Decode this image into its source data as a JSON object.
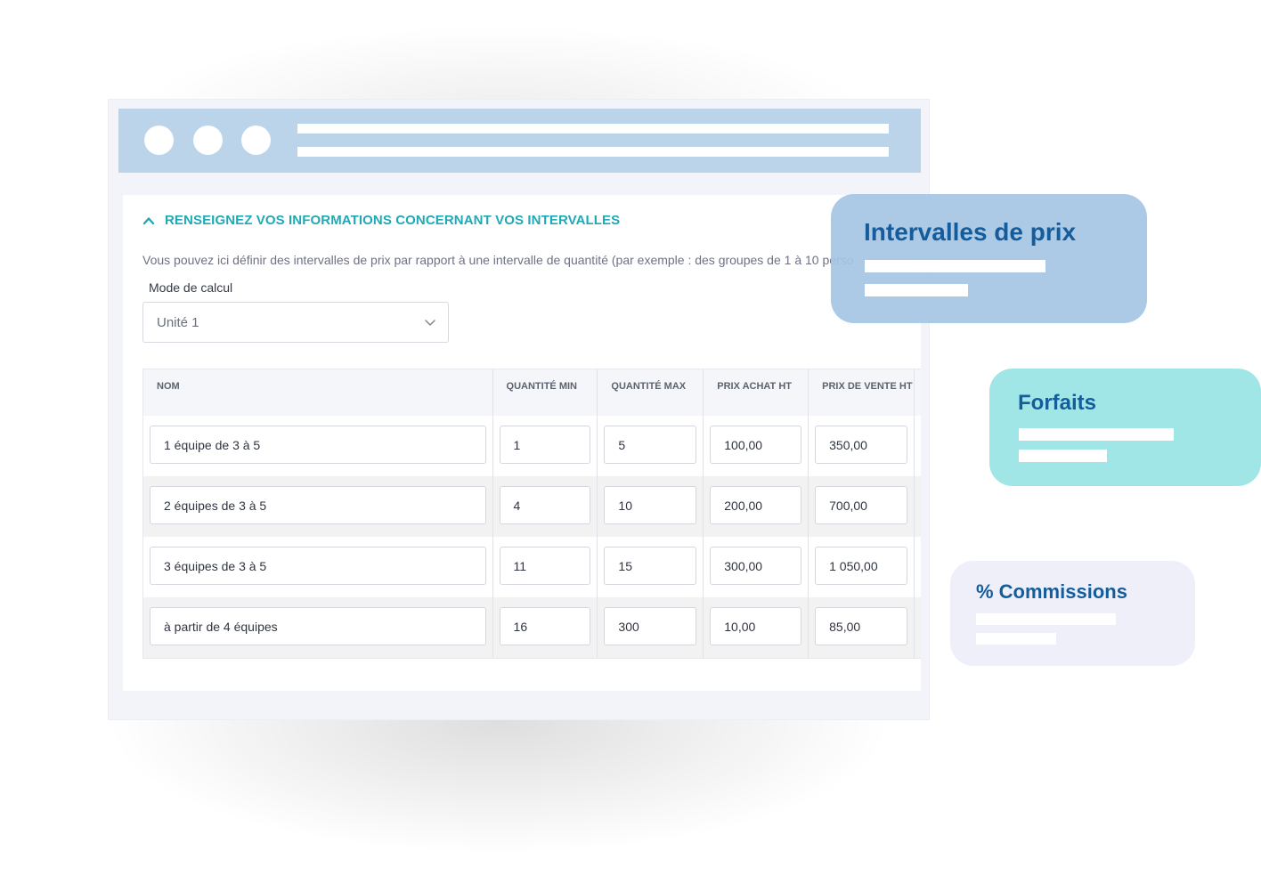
{
  "window": {
    "section_title": "RENSEIGNEZ VOS INFORMATIONS CONCERNANT VOS INTERVALLES",
    "description": "Vous pouvez ici définir des intervalles de prix par rapport à une intervalle de quantité (par exemple : des groupes de 1 à 10 perso",
    "calc_mode": {
      "label": "Mode de calcul",
      "value": "Unité 1"
    },
    "table": {
      "headers": [
        "NOM",
        "QUANTITÉ MIN",
        "QUANTITÉ MAX",
        "PRIX ACHAT HT",
        "PRIX DE VENTE HT"
      ],
      "rows": [
        [
          "1 équipe de 3 à 5",
          "1",
          "5",
          "100,00",
          "350,00"
        ],
        [
          "2 équipes de 3 à 5",
          "4",
          "10",
          "200,00",
          "700,00"
        ],
        [
          "3 équipes de 3 à 5",
          "11",
          "15",
          "300,00",
          "1 050,00"
        ],
        [
          "à partir de 4 équipes",
          "16",
          "300",
          "10,00",
          "85,00"
        ]
      ]
    }
  },
  "cards": [
    {
      "title": "Intervalles de prix"
    },
    {
      "title": "Forfaits"
    },
    {
      "title": "% Commissions"
    }
  ],
  "colors": {
    "accent": "#1fa9b6",
    "titlebar": "#bcd4ea",
    "card_title": "#155c9c"
  },
  "icons": {
    "section_toggle": "chevron-up-icon",
    "select_toggle": "chevron-down-icon"
  }
}
